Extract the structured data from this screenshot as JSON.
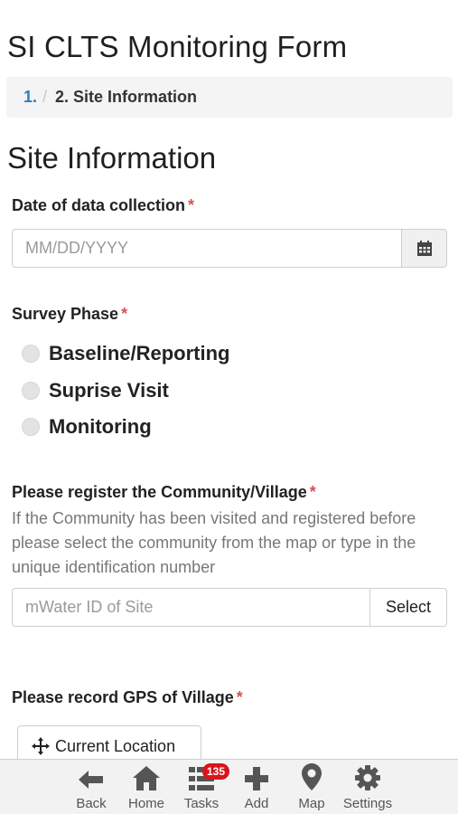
{
  "page": {
    "title": "SI CLTS Monitoring Form"
  },
  "breadcrumb": {
    "step1": "1.",
    "separator": "/",
    "current": "2. Site Information"
  },
  "section": {
    "title": "Site Information"
  },
  "date_question": {
    "label": "Date of data collection",
    "required_mark": "*",
    "placeholder": "MM/DD/YYYY",
    "button_icon": "calendar-icon"
  },
  "survey_phase": {
    "label": "Survey Phase",
    "required_mark": "*",
    "options": [
      "Baseline/Reporting",
      "Suprise Visit",
      "Monitoring"
    ]
  },
  "community": {
    "label": "Please register the Community/Village",
    "required_mark": "*",
    "hint": "If the Community has been visited and registered before please select the community from the map or type in the unique identification number",
    "placeholder": "mWater ID of Site",
    "select_label": "Select"
  },
  "gps": {
    "label": "Please record GPS of Village",
    "required_mark": "*",
    "button_label": "Current Location",
    "button_icon": "crosshair-icon"
  },
  "bottom_nav": {
    "items": [
      {
        "label": "Back",
        "icon": "arrow-left-icon"
      },
      {
        "label": "Home",
        "icon": "home-icon"
      },
      {
        "label": "Tasks",
        "icon": "list-icon",
        "badge": "135"
      },
      {
        "label": "Add",
        "icon": "plus-icon"
      },
      {
        "label": "Map",
        "icon": "map-pin-icon"
      },
      {
        "label": "Settings",
        "icon": "gear-icon"
      }
    ]
  },
  "colors": {
    "link": "#2a7fc4",
    "required": "#d9534f",
    "badge": "#d9141b"
  }
}
